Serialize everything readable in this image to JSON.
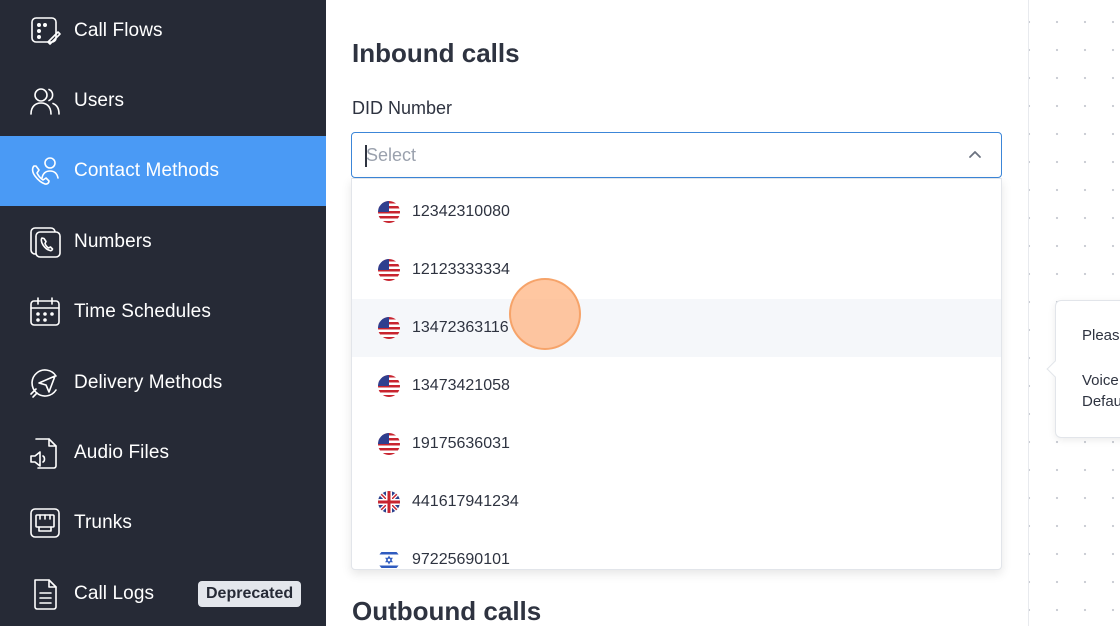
{
  "sidebar": {
    "items": [
      {
        "label": "Call Flows",
        "icon": "call-flows-icon",
        "active": false
      },
      {
        "label": "Users",
        "icon": "users-icon",
        "active": false
      },
      {
        "label": "Contact Methods",
        "icon": "contact-methods-icon",
        "active": true
      },
      {
        "label": "Numbers",
        "icon": "numbers-icon",
        "active": false
      },
      {
        "label": "Time Schedules",
        "icon": "calendar-icon",
        "active": false
      },
      {
        "label": "Delivery Methods",
        "icon": "paper-plane-icon",
        "active": false
      },
      {
        "label": "Audio Files",
        "icon": "audio-file-icon",
        "active": false
      },
      {
        "label": "Trunks",
        "icon": "trunks-icon",
        "active": false
      },
      {
        "label": "Call Logs",
        "icon": "call-logs-icon",
        "active": false,
        "badge": "Deprecated"
      }
    ]
  },
  "main": {
    "inbound_title": "Inbound calls",
    "did_label": "DID Number",
    "select_placeholder": "Select",
    "options": [
      {
        "value": "12342310080",
        "flag": "us"
      },
      {
        "value": "12123333334",
        "flag": "us"
      },
      {
        "value": "13472363116",
        "flag": "us"
      },
      {
        "value": "13473421058",
        "flag": "us"
      },
      {
        "value": "19175636031",
        "flag": "us"
      },
      {
        "value": "441617941234",
        "flag": "gb"
      },
      {
        "value": "97225690101",
        "flag": "il"
      }
    ],
    "outbound_title": "Outbound calls"
  },
  "popover": {
    "line1": "Pleas",
    "line2": "Voice",
    "line3": "Defau"
  },
  "colors": {
    "sidebar_bg": "#262a36",
    "active_bg": "#4a9af5",
    "focus_border": "#3c86d8"
  }
}
